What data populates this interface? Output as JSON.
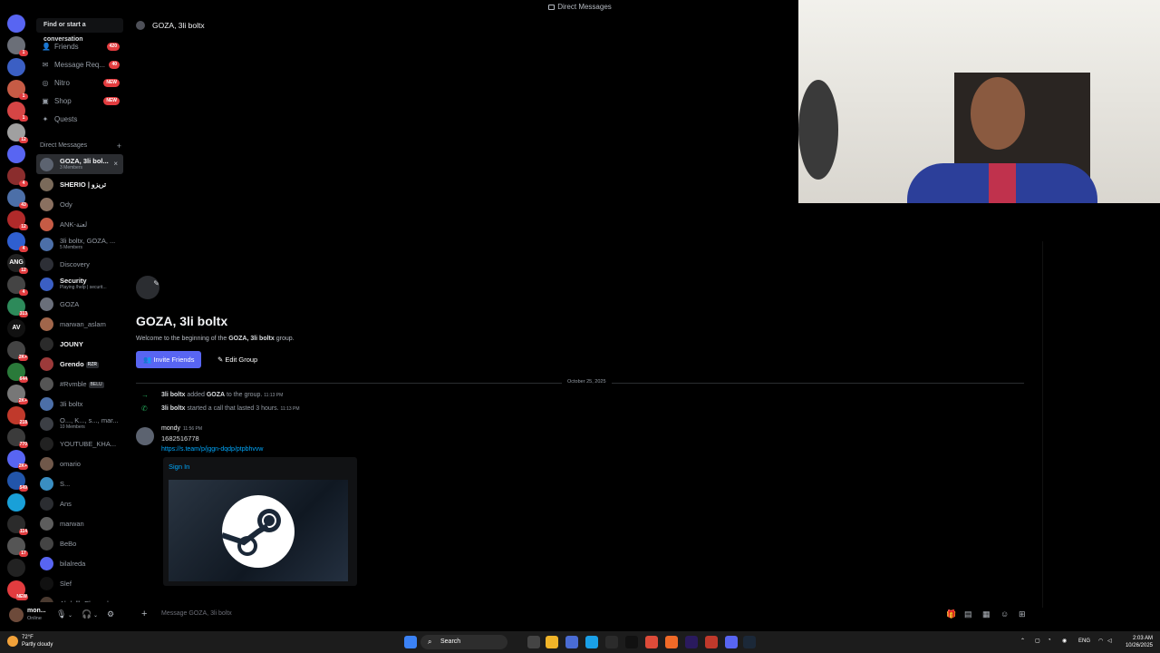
{
  "window": {
    "title": "Direct Messages"
  },
  "servers": [
    {
      "badge": ""
    },
    {
      "badge": "1"
    },
    {
      "badge": ""
    },
    {
      "badge": "1"
    },
    {
      "badge": "1"
    },
    {
      "badge": "12"
    },
    {
      "badge": ""
    },
    {
      "badge": "4"
    },
    {
      "badge": "43"
    },
    {
      "badge": "12"
    },
    {
      "badge": "4"
    },
    {
      "badge": "12"
    },
    {
      "badge": "4"
    },
    {
      "badge": "313"
    },
    {
      "badge": ""
    },
    {
      "badge": "2K+"
    },
    {
      "badge": "644"
    },
    {
      "badge": "2K+"
    },
    {
      "badge": "218"
    },
    {
      "badge": "770"
    },
    {
      "badge": "2K+"
    },
    {
      "badge": "549"
    },
    {
      "badge": ""
    },
    {
      "badge": "114"
    },
    {
      "badge": "17"
    },
    {
      "badge": ""
    },
    {
      "badge": "NEW"
    }
  ],
  "server_texts": [
    "",
    "",
    "",
    "",
    "",
    "",
    "",
    "",
    "",
    "",
    "",
    "ANG",
    "",
    "",
    "AV",
    "",
    "",
    "",
    "",
    "",
    "",
    "",
    "",
    "",
    "",
    "",
    ""
  ],
  "sidebar": {
    "search_placeholder": "Find or start a conversation",
    "nav": [
      {
        "label": "Friends",
        "badge": "420"
      },
      {
        "label": "Message Req...",
        "badge": "40"
      },
      {
        "label": "Nitro",
        "badge": "NEW"
      },
      {
        "label": "Shop",
        "badge": "NEW"
      },
      {
        "label": "Quests",
        "badge": ""
      }
    ],
    "dm_header": "Direct Messages",
    "dms": [
      {
        "name": "GOZA, 3li bol...",
        "sub": "3 Members"
      },
      {
        "name": "SHERIO | تريزو",
        "sub": ""
      },
      {
        "name": "Ody",
        "sub": ""
      },
      {
        "name": "ANK-لعنة",
        "sub": ""
      },
      {
        "name": "3li boltx, GOZA, ...",
        "sub": "5 Members"
      },
      {
        "name": "Discovery",
        "sub": ""
      },
      {
        "name": "Security",
        "sub": "Playing /help | securit..."
      },
      {
        "name": "GOZA",
        "sub": ""
      },
      {
        "name": "marwan_aslam",
        "sub": ""
      },
      {
        "name": "JOUNY",
        "sub": ""
      },
      {
        "name": "Grendo",
        "sub": ""
      },
      {
        "name": "#Rvmble",
        "sub": ""
      },
      {
        "name": "3li boltx",
        "sub": ""
      },
      {
        "name": "O..., K..., s..., mar...",
        "sub": "10 Members"
      },
      {
        "name": "YOUTUBE_KHA...",
        "sub": ""
      },
      {
        "name": "omario",
        "sub": ""
      },
      {
        "name": "S...",
        "sub": ""
      },
      {
        "name": "Ans",
        "sub": ""
      },
      {
        "name": "marwan",
        "sub": ""
      },
      {
        "name": "BeBo",
        "sub": ""
      },
      {
        "name": "bilalreda",
        "sub": ""
      },
      {
        "name": "Slef",
        "sub": ""
      },
      {
        "name": "Abdullh Elsayed",
        "sub": ""
      }
    ],
    "tags": {
      "grendo": "RZR",
      "rvmble": "BELU"
    }
  },
  "user": {
    "name": "mon...",
    "status": "Online"
  },
  "chat": {
    "header_title": "GOZA, 3li boltx",
    "group_title": "GOZA, 3li boltx",
    "welcome_prefix": "Welcome to the beginning of the ",
    "welcome_group": "GOZA, 3li boltx",
    "welcome_suffix": " group.",
    "invite_label": "Invite Friends",
    "edit_label": "Edit Group",
    "date_divider": "October 25, 2025",
    "system": [
      {
        "actor": "3li boltx",
        "text_a": " added ",
        "target": "GOZA",
        "text_b": " to the group.",
        "time": "11:13 PM"
      },
      {
        "actor": "3li boltx",
        "text_a": " started a call that lasted 3 hours.",
        "target": "",
        "text_b": "",
        "time": "11:13 PM"
      }
    ],
    "message": {
      "author": "mondy",
      "time": "11:56 PM",
      "content": "1682516778",
      "link": "https://s.team/p/jggn-dqdp/ptpbhvvw"
    },
    "embed_title": "Sign In",
    "composer_placeholder": "Message GOZA, 3li boltx"
  },
  "taskbar": {
    "weather_temp": "72°F",
    "weather_desc": "Partly cloudy",
    "search_label": "Search",
    "lang": "ENG",
    "time": "2:03 AM",
    "date": "10/26/2025"
  },
  "colors": {
    "accent": "#5865f2",
    "link": "#00a8fc",
    "badge": "#e23c3f",
    "online": "#23a559"
  }
}
